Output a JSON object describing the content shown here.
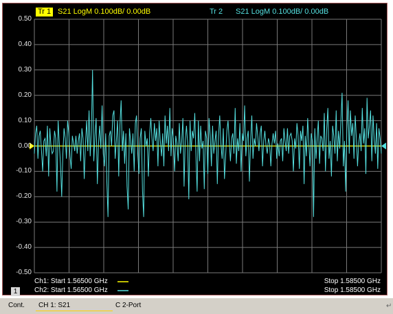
{
  "header": {
    "trace1_tag": "Tr 1",
    "trace1_label": "S21 LogM 0.100dB/ 0.00dB",
    "trace2_tag": "Tr 2",
    "trace2_label": "S21 LogM 0.100dB/ 0.00dB"
  },
  "y_axis": {
    "ticks": [
      "0.50",
      "0.40",
      "0.30",
      "0.20",
      "0.10",
      "0.00",
      "-0.10",
      "-0.20",
      "-0.30",
      "-0.40",
      "-0.50"
    ]
  },
  "footer": {
    "channel_number": "1",
    "ch1_start": "Ch1: Start  1.56500 GHz",
    "ch2_start": "Ch2: Start  1.56500 GHz",
    "ch1_stop": "Stop  1.58500 GHz",
    "ch2_stop": "Stop  1.58500 GHz"
  },
  "status_bar": {
    "mode": "Cont.",
    "channel": "CH 1:  S21",
    "port": "C  2-Port"
  },
  "colors": {
    "trace1": "#ffff00",
    "trace2": "#55e0e0",
    "grid": "#7a7a7a",
    "background": "#000000"
  },
  "chart_data": {
    "type": "line",
    "ylim": [
      -0.5,
      0.5
    ],
    "x_start_ghz": 1.565,
    "x_stop_ghz": 1.585,
    "grid": true,
    "series": [
      {
        "name": "Tr 1",
        "constant": 0.0
      },
      {
        "name": "Tr 2",
        "values": [
          -0.03,
          0.05,
          0.08,
          -0.05,
          0.04,
          0.06,
          -0.02,
          -0.1,
          0.02,
          0.03,
          -0.04,
          0.08,
          -0.12,
          0.07,
          0.0,
          -0.03,
          -0.02,
          0.06,
          0.03,
          -0.18,
          0.1,
          0.01,
          -0.07,
          -0.2,
          -0.03,
          0.07,
          0.03,
          -0.05,
          0.1,
          0.05,
          -0.04,
          -0.09,
          0.04,
          0.01,
          -0.02,
          0.04,
          -0.03,
          0.02,
          0.05,
          -0.06,
          0.07,
          0.03,
          -0.13,
          0.01,
          0.1,
          -0.02,
          0.14,
          -0.04,
          0.06,
          0.3,
          -0.06,
          0.04,
          0.11,
          -0.15,
          0.01,
          0.08,
          -0.01,
          0.16,
          -0.03,
          -0.08,
          0.05,
          -0.14,
          -0.28,
          0.04,
          0.06,
          0.0,
          0.12,
          0.14,
          -0.05,
          0.02,
          0.1,
          -0.12,
          0.08,
          0.18,
          -0.02,
          0.06,
          -0.07,
          0.05,
          -0.16,
          -0.25,
          0.07,
          0.02,
          -0.03,
          0.05,
          -0.1,
          0.09,
          0.12,
          -0.03,
          -0.11,
          0.03,
          0.07,
          -0.18,
          -0.28,
          0.06,
          0.0,
          0.03,
          -0.12,
          0.05,
          0.11,
          0.03,
          -0.02,
          0.09,
          0.02,
          0.07,
          -0.08,
          0.1,
          0.02,
          -0.04,
          0.05,
          -0.08,
          0.12,
          0.01,
          0.08,
          -0.02,
          0.15,
          -0.04,
          0.07,
          0.03,
          -0.1,
          0.04,
          0.01,
          -0.06,
          0.09,
          -0.03,
          0.02,
          0.11,
          -0.16,
          0.02,
          0.08,
          0.01,
          -0.21,
          0.1,
          -0.02,
          0.06,
          0.03,
          0.13,
          -0.04,
          -0.18,
          0.1,
          -0.06,
          0.08,
          -0.01,
          0.02,
          -0.17,
          0.06,
          0.03,
          -0.11,
          0.11,
          0.04,
          -0.08,
          0.08,
          -0.03,
          0.02,
          0.06,
          -0.15,
          0.04,
          0.12,
          0.01,
          -0.05,
          0.07,
          -0.13,
          -0.04,
          0.06,
          0.1,
          0.02,
          -0.06,
          0.03,
          0.05,
          -0.03,
          0.15,
          -0.07,
          0.03,
          -0.02,
          0.09,
          -0.1,
          0.05,
          0.02,
          0.16,
          -0.04,
          0.03,
          0.06,
          -0.14,
          0.02,
          0.12,
          -0.05,
          0.03,
          0.0,
          0.09,
          0.04,
          -0.02,
          0.05,
          0.08,
          -0.08,
          0.02,
          0.06,
          0.0,
          -0.03,
          0.03,
          0.01,
          -0.08,
          0.01,
          0.05,
          0.01,
          0.06,
          -0.05,
          0.01,
          -0.04,
          0.02,
          0.03,
          -0.06,
          0.07,
          0.02,
          -0.02,
          0.07,
          -0.03,
          0.04,
          0.05,
          0.02,
          -0.1,
          0.03,
          -0.01,
          0.09,
          0.04,
          -0.09,
          0.06,
          0.02,
          0.08,
          -0.15,
          0.04,
          -0.04,
          0.11,
          0.01,
          -0.08,
          0.05,
          0.02,
          -0.28,
          0.07,
          -0.05,
          0.03,
          0.1,
          -0.07,
          0.04,
          0.03,
          -0.02,
          0.13,
          -0.1,
          0.06,
          0.15,
          -0.05,
          0.02,
          -0.12,
          0.08,
          0.04,
          -0.03,
          0.14,
          -0.06,
          0.06,
          -0.01,
          0.1,
          0.21,
          -0.08,
          0.02,
          -0.18,
          0.06,
          0.18,
          -0.03,
          0.14,
          0.04,
          0.09,
          -0.05,
          0.12,
          0.03,
          -0.08,
          0.01,
          0.05,
          -0.02,
          0.15,
          0.01,
          0.07,
          -0.11,
          0.19,
          0.03,
          0.08,
          0.14,
          -0.06,
          0.12,
          0.03,
          -0.03,
          0.09,
          -0.09,
          0.07,
          0.03,
          -0.03
        ]
      }
    ]
  }
}
